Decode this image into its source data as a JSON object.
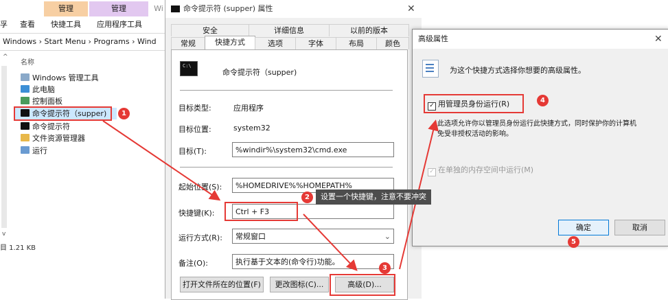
{
  "explorer": {
    "ribbon": {
      "manage1": "管理",
      "manage2": "管理",
      "wi": "Wi"
    },
    "ribbon_sub": {
      "left": "孚",
      "view": "查看",
      "shortcut_tools": "快捷工具",
      "app_tools": "应用程序工具"
    },
    "address": "Windows  ›  Start Menu  ›  Programs  ›  Wind",
    "column_name": "名称",
    "files": [
      {
        "label": "Windows 管理工具"
      },
      {
        "label": "此电脑"
      },
      {
        "label": "控制面板"
      },
      {
        "label": "命令提示符（supper)"
      },
      {
        "label": "命令提示符"
      },
      {
        "label": "文件资源管理器"
      },
      {
        "label": "运行"
      }
    ],
    "status": "目  1.21 KB"
  },
  "props": {
    "title": "命令提示符 (supper) 属性",
    "tabs_top": [
      "安全",
      "详细信息",
      "以前的版本"
    ],
    "tabs_bottom": [
      "常规",
      "快捷方式",
      "选项",
      "字体",
      "布局",
      "颜色"
    ],
    "name": "命令提示符（supper)",
    "target_type_label": "目标类型:",
    "target_type": "应用程序",
    "target_loc_label": "目标位置:",
    "target_loc": "system32",
    "target_label": "目标(T):",
    "target": "%windir%\\system32\\cmd.exe",
    "start_label": "起始位置(S):",
    "start": "%HOMEDRIVE%%HOMEPATH%",
    "hotkey_label": "快捷键(K):",
    "hotkey": "Ctrl + F3",
    "run_label": "运行方式(R):",
    "run": "常规窗口",
    "comment_label": "备注(O):",
    "comment": "执行基于文本的(命令行)功能。",
    "btn_open_loc": "打开文件所在的位置(F)",
    "btn_change_icon": "更改图标(C)...",
    "btn_advanced": "高级(D)..."
  },
  "adv": {
    "title": "高级属性",
    "desc": "为这个快捷方式选择你想要的高级属性。",
    "run_as_admin": "用管理员身份运行(R)",
    "admin_note_1": "此选项允许你以管理员身份运行此快捷方式，同时保护你的计算机",
    "admin_note_2": "免受非授权活动的影响。",
    "separate_mem": "在单独的内存空间中运行(M)",
    "ok": "确定",
    "cancel": "取消"
  },
  "annotations": {
    "b1": "1",
    "b2": "2",
    "b3": "3",
    "b4": "4",
    "b5": "5",
    "tooltip": "设置一个快捷键，注意不要冲突"
  },
  "colors": {
    "accent_red": "#e53935",
    "manage_orange": "#f7cfa3",
    "manage_purple": "#e2c8f0",
    "selection_blue": "#cce8ff"
  }
}
